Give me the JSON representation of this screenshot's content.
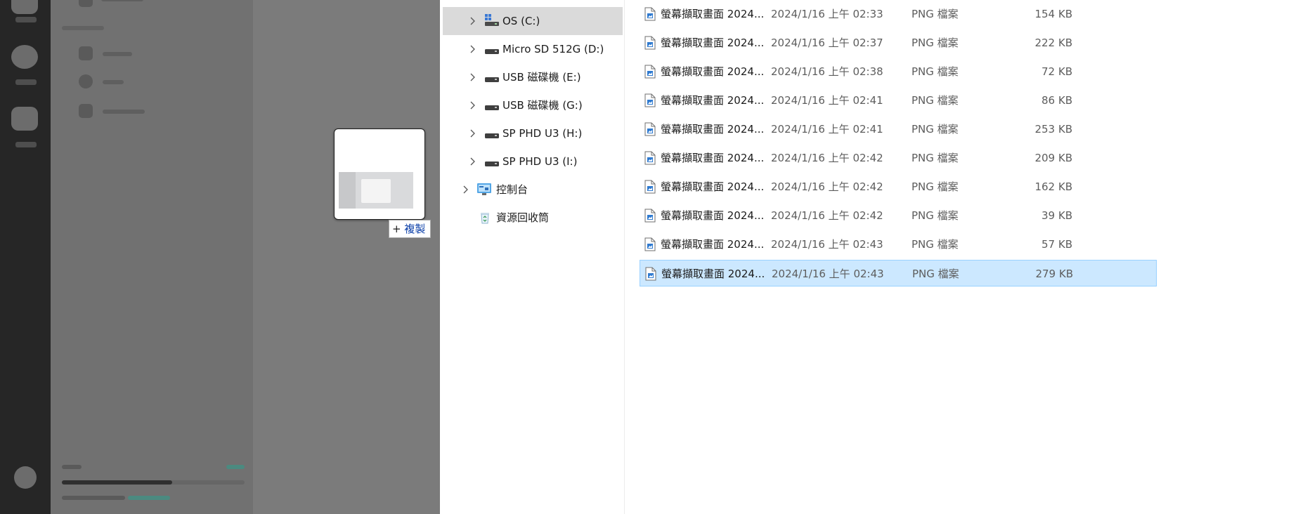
{
  "drag": {
    "tooltip_prefix": "+",
    "tooltip_label": "複製"
  },
  "nav": {
    "items": [
      {
        "label": "OS (C:)",
        "icon": "os-drive-icon",
        "expandable": true,
        "selected": true
      },
      {
        "label": "Micro SD 512G (D:)",
        "icon": "drive-icon",
        "expandable": true,
        "selected": false
      },
      {
        "label": "USB 磁碟機 (E:)",
        "icon": "drive-icon",
        "expandable": true,
        "selected": false
      },
      {
        "label": "USB 磁碟機 (G:)",
        "icon": "drive-icon",
        "expandable": true,
        "selected": false
      },
      {
        "label": "SP PHD U3 (H:)",
        "icon": "drive-icon",
        "expandable": true,
        "selected": false
      },
      {
        "label": "SP PHD U3 (I:)",
        "icon": "drive-icon",
        "expandable": true,
        "selected": false
      },
      {
        "label": "控制台",
        "icon": "control-panel-icon",
        "expandable": true,
        "selected": false
      },
      {
        "label": "資源回收筒",
        "icon": "recycle-bin-icon",
        "expandable": false,
        "selected": false
      }
    ]
  },
  "files": [
    {
      "name": "螢幕擷取畫面 2024...",
      "date": "2024/1/16 上午 02:33",
      "type": "PNG 檔案",
      "size": "154 KB"
    },
    {
      "name": "螢幕擷取畫面 2024...",
      "date": "2024/1/16 上午 02:37",
      "type": "PNG 檔案",
      "size": "222 KB"
    },
    {
      "name": "螢幕擷取畫面 2024...",
      "date": "2024/1/16 上午 02:38",
      "type": "PNG 檔案",
      "size": "72 KB"
    },
    {
      "name": "螢幕擷取畫面 2024...",
      "date": "2024/1/16 上午 02:41",
      "type": "PNG 檔案",
      "size": "86 KB"
    },
    {
      "name": "螢幕擷取畫面 2024...",
      "date": "2024/1/16 上午 02:41",
      "type": "PNG 檔案",
      "size": "253 KB"
    },
    {
      "name": "螢幕擷取畫面 2024...",
      "date": "2024/1/16 上午 02:42",
      "type": "PNG 檔案",
      "size": "209 KB"
    },
    {
      "name": "螢幕擷取畫面 2024...",
      "date": "2024/1/16 上午 02:42",
      "type": "PNG 檔案",
      "size": "162 KB"
    },
    {
      "name": "螢幕擷取畫面 2024...",
      "date": "2024/1/16 上午 02:42",
      "type": "PNG 檔案",
      "size": "39 KB"
    },
    {
      "name": "螢幕擷取畫面 2024...",
      "date": "2024/1/16 上午 02:43",
      "type": "PNG 檔案",
      "size": "57 KB"
    },
    {
      "name": "螢幕擷取畫面 2024...",
      "date": "2024/1/16 上午 02:43",
      "type": "PNG 檔案",
      "size": "279 KB"
    }
  ],
  "colors": {
    "selection": "#cce8ff",
    "selection_border": "#99d1ff",
    "nav_selected": "#dadada",
    "overlay": "#7a7a7a"
  }
}
